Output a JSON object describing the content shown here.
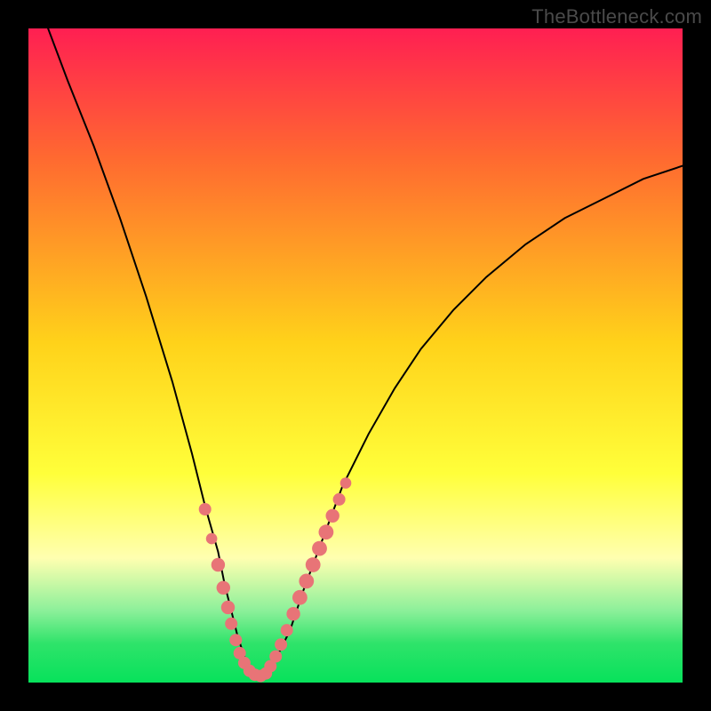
{
  "watermark": "TheBottleneck.com",
  "colors": {
    "frame": "#000000",
    "grad_top": "#ff1f52",
    "grad_mid1": "#ff6a30",
    "grad_mid2": "#ffd21a",
    "grad_mid3": "#ffff3a",
    "grad_band_pale": "#ffffb0",
    "grad_band_green1": "#8cf09a",
    "grad_band_green2": "#2fe36a",
    "grad_bottom": "#07e25b",
    "curve": "#000000",
    "marker_fill": "#e87477",
    "marker_stroke": "#c85a5f"
  },
  "chart_data": {
    "type": "line",
    "title": "",
    "xlabel": "",
    "ylabel": "",
    "xlim": [
      0,
      100
    ],
    "ylim": [
      0,
      100
    ],
    "grid": false,
    "series": [
      {
        "name": "bottleneck-curve",
        "x": [
          3,
          6,
          10,
          14,
          18,
          22,
          25,
          27,
          29,
          30,
          31,
          32,
          33,
          34,
          35,
          36,
          37,
          38,
          40,
          42,
          45,
          48,
          52,
          56,
          60,
          65,
          70,
          76,
          82,
          88,
          94,
          100
        ],
        "y": [
          100,
          92,
          82,
          71,
          59,
          46,
          35,
          27,
          20,
          15,
          11,
          7,
          4,
          2,
          1,
          1,
          2,
          4,
          8,
          14,
          22,
          30,
          38,
          45,
          51,
          57,
          62,
          67,
          71,
          74,
          77,
          79
        ]
      }
    ],
    "markers": [
      {
        "x": 27.0,
        "y": 26.5,
        "r": 1.0
      },
      {
        "x": 28.0,
        "y": 22.0,
        "r": 0.9
      },
      {
        "x": 29.0,
        "y": 18.0,
        "r": 1.1
      },
      {
        "x": 29.8,
        "y": 14.5,
        "r": 1.1
      },
      {
        "x": 30.5,
        "y": 11.5,
        "r": 1.1
      },
      {
        "x": 31.0,
        "y": 9.0,
        "r": 1.0
      },
      {
        "x": 31.7,
        "y": 6.5,
        "r": 1.0
      },
      {
        "x": 32.3,
        "y": 4.5,
        "r": 1.0
      },
      {
        "x": 33.0,
        "y": 3.0,
        "r": 1.0
      },
      {
        "x": 33.8,
        "y": 1.8,
        "r": 1.0
      },
      {
        "x": 34.6,
        "y": 1.2,
        "r": 1.0
      },
      {
        "x": 35.5,
        "y": 1.0,
        "r": 1.0
      },
      {
        "x": 36.3,
        "y": 1.4,
        "r": 1.0
      },
      {
        "x": 37.0,
        "y": 2.5,
        "r": 1.0
      },
      {
        "x": 37.8,
        "y": 4.0,
        "r": 1.0
      },
      {
        "x": 38.6,
        "y": 5.8,
        "r": 1.0
      },
      {
        "x": 39.5,
        "y": 8.0,
        "r": 1.0
      },
      {
        "x": 40.5,
        "y": 10.5,
        "r": 1.1
      },
      {
        "x": 41.5,
        "y": 13.0,
        "r": 1.2
      },
      {
        "x": 42.5,
        "y": 15.5,
        "r": 1.2
      },
      {
        "x": 43.5,
        "y": 18.0,
        "r": 1.2
      },
      {
        "x": 44.5,
        "y": 20.5,
        "r": 1.2
      },
      {
        "x": 45.5,
        "y": 23.0,
        "r": 1.2
      },
      {
        "x": 46.5,
        "y": 25.5,
        "r": 1.1
      },
      {
        "x": 47.5,
        "y": 28.0,
        "r": 1.0
      },
      {
        "x": 48.5,
        "y": 30.5,
        "r": 0.9
      }
    ]
  }
}
